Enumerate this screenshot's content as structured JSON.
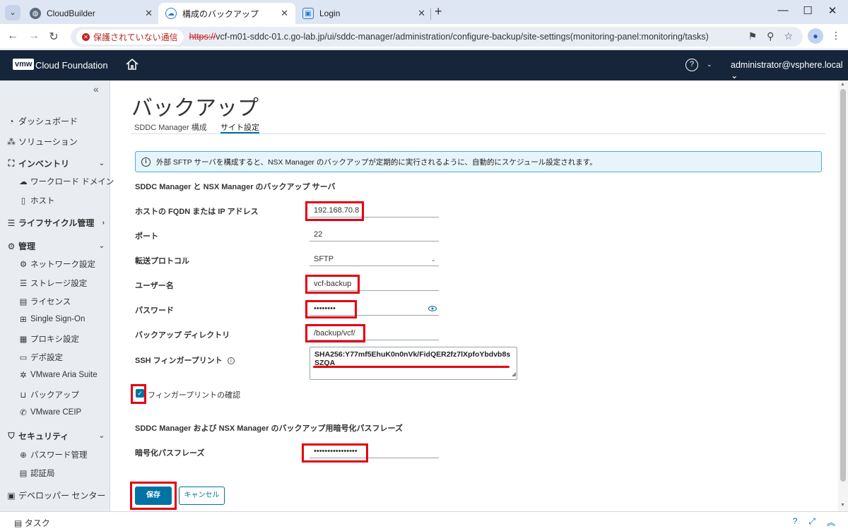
{
  "browser": {
    "tabs": [
      {
        "title": "CloudBuilder",
        "active": false
      },
      {
        "title": "構成のバックアップ",
        "active": true
      },
      {
        "title": "Login",
        "active": false
      }
    ],
    "new_tab": "+",
    "insecure_label": "保護されていない通信",
    "url_scheme": "https://",
    "url_rest": "vcf-m01-sddc-01.c.go-lab.jp/ui/sddc-manager/administration/configure-backup/site-settings(monitoring-panel:monitoring/tasks)"
  },
  "header": {
    "logo": "vmw",
    "title": "Cloud Foundation",
    "help": "?",
    "user": "administrator@vsphere.local ⌄"
  },
  "sidebar": {
    "collapse": "«",
    "items": [
      {
        "label": "ダッシュボード"
      },
      {
        "label": "ソリューション"
      },
      {
        "label": "インベントリ"
      },
      {
        "label": "ワークロード ドメイン"
      },
      {
        "label": "ホスト"
      },
      {
        "label": "ライフサイクル管理"
      },
      {
        "label": "管理"
      },
      {
        "label": "ネットワーク設定"
      },
      {
        "label": "ストレージ設定"
      },
      {
        "label": "ライセンス"
      },
      {
        "label": "Single Sign-On"
      },
      {
        "label": "プロキシ設定"
      },
      {
        "label": "デポ設定"
      },
      {
        "label": "VMware Aria Suite"
      },
      {
        "label": "バックアップ"
      },
      {
        "label": "VMware CEIP"
      },
      {
        "label": "セキュリティ"
      },
      {
        "label": "パスワード管理"
      },
      {
        "label": "認証局"
      },
      {
        "label": "デベロッパー センター"
      }
    ]
  },
  "main": {
    "title": "バックアップ",
    "tabs": [
      {
        "label": "SDDC Manager 構成"
      },
      {
        "label": "サイト設定"
      }
    ],
    "info_banner": "外部 SFTP サーバを構成すると、NSX Manager のバックアップが定期的に実行されるように、自動的にスケジュール設定されます。",
    "section_server": "SDDC Manager と NSX Manager のバックアップ サーバ",
    "fields": {
      "host": {
        "label": "ホストの FQDN または IP アドレス",
        "value": "192.168.70.8"
      },
      "port": {
        "label": "ポート",
        "value": "22"
      },
      "protocol": {
        "label": "転送プロトコル",
        "value": "SFTP"
      },
      "username": {
        "label": "ユーザー名",
        "value": "vcf-backup"
      },
      "password": {
        "label": "パスワード",
        "value": "••••••••"
      },
      "directory": {
        "label": "バックアップ ディレクトリ",
        "value": "/backup/vcf/"
      },
      "ssh": {
        "label": "SSH フィンガープリント",
        "value": "SHA256:Y77mf5EhuK0n0nVk/FidQER2fz7lXpfoYbdvb8sSZQA"
      }
    },
    "confirm_fingerprint": "フィンガープリントの確認",
    "section_encryption": "SDDC Manager および NSX Manager のバックアップ用暗号化パスフレーズ",
    "passphrase": {
      "label": "暗号化パスフレーズ",
      "value": "••••••••••••••••"
    },
    "save_label": "保存",
    "cancel_label": "キャンセル"
  },
  "taskbar": {
    "label": "タスク"
  },
  "colors": {
    "header_bg": "#16253a",
    "primary": "#0072a3",
    "highlight": "#e3000f",
    "sidebar_bg": "#e9edf2"
  }
}
